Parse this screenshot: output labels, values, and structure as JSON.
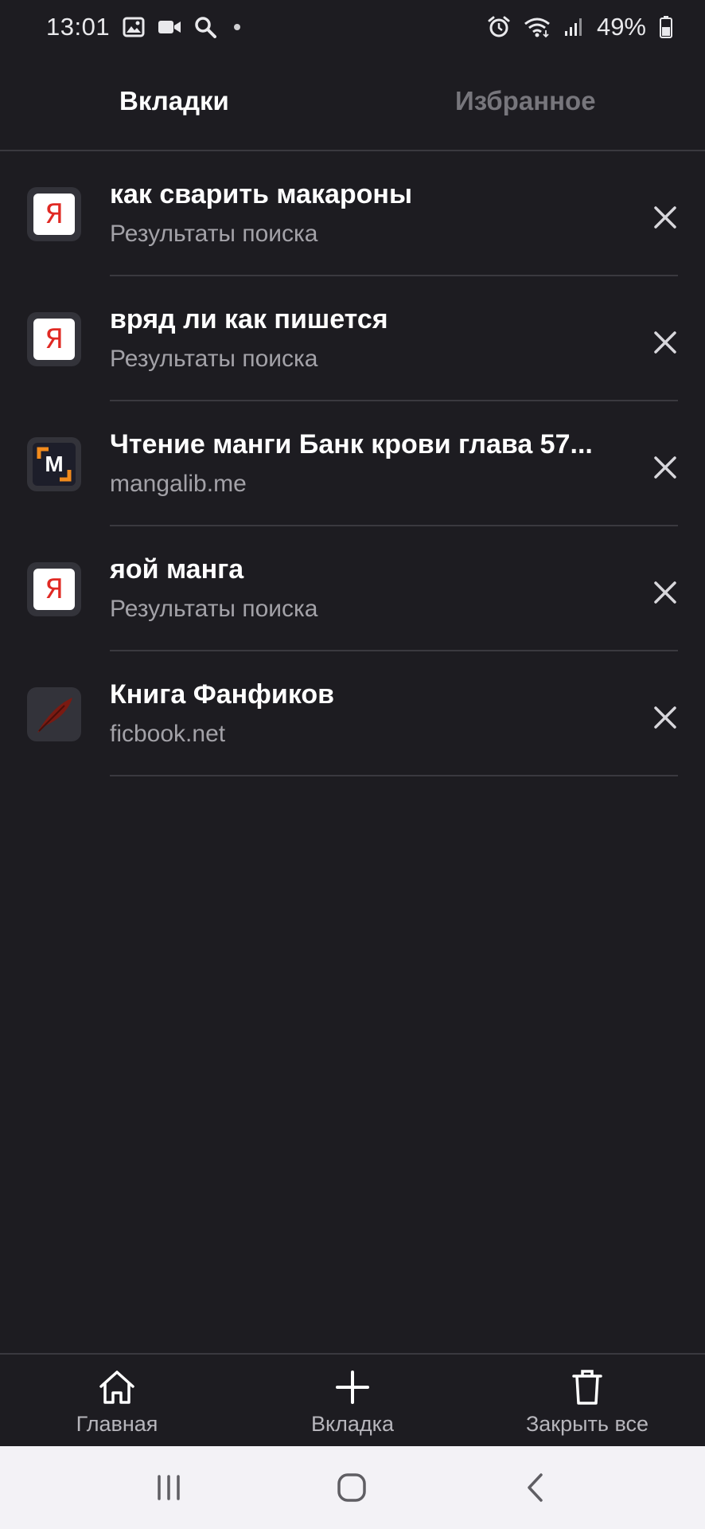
{
  "status_bar": {
    "time": "13:01",
    "battery": "49%",
    "left_icons": [
      "gallery-icon",
      "video-icon",
      "search-icon",
      "notification-dot"
    ],
    "right_icons": [
      "alarm-icon",
      "wifi-icon",
      "signal-icon",
      "battery-icon"
    ]
  },
  "header": {
    "tabs": [
      {
        "label": "Вкладки",
        "active": true
      },
      {
        "label": "Избранное",
        "active": false
      }
    ]
  },
  "tabs": [
    {
      "favicon": "yandex-icon",
      "favicon_text": "Я",
      "title": "как сварить макароны",
      "subtitle": "Результаты поиска"
    },
    {
      "favicon": "yandex-icon",
      "favicon_text": "Я",
      "title": "вряд ли как пишется",
      "subtitle": "Результаты поиска"
    },
    {
      "favicon": "mangalib-icon",
      "favicon_text": "M",
      "title": "Чтение манги Банк крови глава 57...",
      "subtitle": "mangalib.me"
    },
    {
      "favicon": "yandex-icon",
      "favicon_text": "Я",
      "title": "яой манга",
      "subtitle": "Результаты поиска"
    },
    {
      "favicon": "ficbook-quill-icon",
      "favicon_text": "",
      "title": "Книга Фанфиков",
      "subtitle": "ficbook.net"
    }
  ],
  "bottom_bar": {
    "home_label": "Главная",
    "new_tab_label": "Вкладка",
    "close_all_label": "Закрыть все"
  },
  "colors": {
    "background": "#1d1c21",
    "divider": "#3a393f",
    "subtitle": "#a3a2a8",
    "yandex_red": "#e02a24",
    "manga_orange": "#f28b1c",
    "ficbook_red": "#7a1a12"
  }
}
